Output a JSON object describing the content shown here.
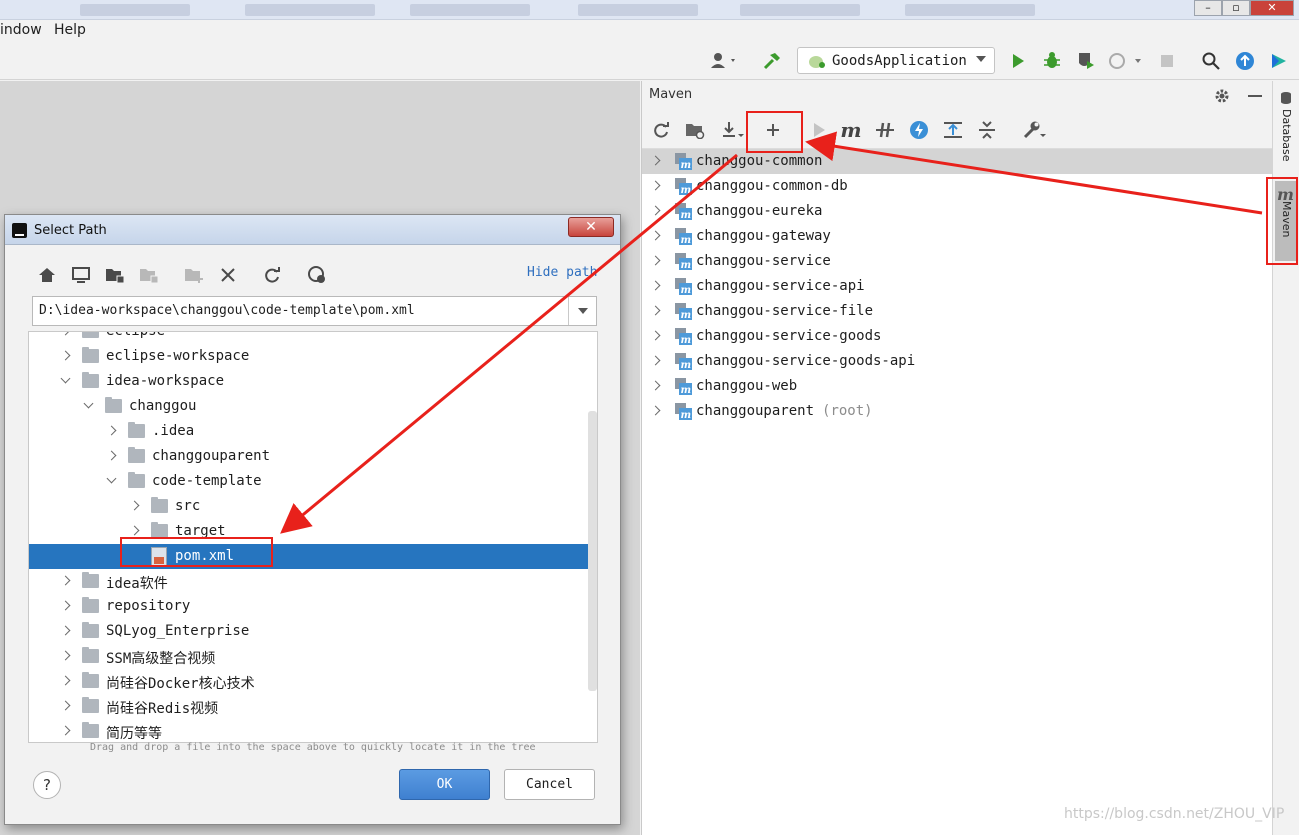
{
  "menubar": {
    "items": [
      "indow",
      "Help"
    ]
  },
  "toolbar": {
    "run_config": "GoodsApplication"
  },
  "maven": {
    "title": "Maven",
    "projects": [
      {
        "name": "changgou-common",
        "tag": ""
      },
      {
        "name": "changgou-common-db",
        "tag": ""
      },
      {
        "name": "changgou-eureka",
        "tag": ""
      },
      {
        "name": "changgou-gateway",
        "tag": ""
      },
      {
        "name": "changgou-service",
        "tag": ""
      },
      {
        "name": "changgou-service-api",
        "tag": ""
      },
      {
        "name": "changgou-service-file",
        "tag": ""
      },
      {
        "name": "changgou-service-goods",
        "tag": ""
      },
      {
        "name": "changgou-service-goods-api",
        "tag": ""
      },
      {
        "name": "changgou-web",
        "tag": ""
      },
      {
        "name": "changgouparent",
        "tag": "(root)"
      }
    ]
  },
  "side_tabs": {
    "database": "Database",
    "maven": "Maven"
  },
  "dialog": {
    "title": "Select Path",
    "hide_path": "Hide path",
    "path_value": "D:\\idea-workspace\\changgou\\code-template\\pom.xml",
    "tree": [
      {
        "label": "eclipse",
        "type": "folder",
        "indent": 0,
        "expanded": false,
        "selected": false
      },
      {
        "label": "eclipse-workspace",
        "type": "folder",
        "indent": 0,
        "expanded": false,
        "selected": false
      },
      {
        "label": "idea-workspace",
        "type": "folder",
        "indent": 0,
        "expanded": true,
        "selected": false
      },
      {
        "label": "changgou",
        "type": "folder",
        "indent": 1,
        "expanded": true,
        "selected": false
      },
      {
        "label": ".idea",
        "type": "folder",
        "indent": 2,
        "expanded": false,
        "selected": false
      },
      {
        "label": "changgouparent",
        "type": "folder",
        "indent": 2,
        "expanded": false,
        "selected": false
      },
      {
        "label": "code-template",
        "type": "folder",
        "indent": 2,
        "expanded": true,
        "selected": false
      },
      {
        "label": "src",
        "type": "folder",
        "indent": 3,
        "expanded": false,
        "selected": false
      },
      {
        "label": "target",
        "type": "folder",
        "indent": 3,
        "expanded": false,
        "selected": false
      },
      {
        "label": "pom.xml",
        "type": "xml",
        "indent": 3,
        "expanded": null,
        "selected": true
      },
      {
        "label": "idea软件",
        "type": "folder",
        "indent": 0,
        "expanded": false,
        "selected": false
      },
      {
        "label": "repository",
        "type": "folder",
        "indent": 0,
        "expanded": false,
        "selected": false
      },
      {
        "label": "SQLyog_Enterprise",
        "type": "folder",
        "indent": 0,
        "expanded": false,
        "selected": false
      },
      {
        "label": "SSM高级整合视频",
        "type": "folder",
        "indent": 0,
        "expanded": false,
        "selected": false
      },
      {
        "label": "尚硅谷Docker核心技术",
        "type": "folder",
        "indent": 0,
        "expanded": false,
        "selected": false
      },
      {
        "label": "尚硅谷Redis视频",
        "type": "folder",
        "indent": 0,
        "expanded": false,
        "selected": false
      },
      {
        "label": "简历等等",
        "type": "folder",
        "indent": 0,
        "expanded": false,
        "selected": false
      }
    ],
    "dnd_hint": "Drag and drop a file into the space above to quickly locate it in the tree",
    "help_label": "?",
    "ok_label": "OK",
    "cancel_label": "Cancel"
  },
  "icons": {
    "toolbar": [
      "user-icon",
      "build-hammer-icon",
      "run-icon",
      "debug-icon",
      "coverage-icon",
      "profile-icon",
      "stop-icon",
      "search-icon",
      "update-icon",
      "plugin-icon"
    ],
    "maven_toolbar": [
      "reimport-icon",
      "generate-sources-icon",
      "download-icon",
      "add-maven-project-icon",
      "run-maven-build-icon",
      "execute-goal-icon",
      "toggle-offline-icon",
      "skip-tests-icon",
      "show-dependencies-icon",
      "collapse-all-icon",
      "settings-wrench-icon"
    ],
    "dialog_toolbar": [
      "home-icon",
      "desktop-icon",
      "project-folder-icon",
      "module-folder-icon",
      "new-folder-icon",
      "delete-icon",
      "refresh-icon",
      "show-hidden-icon"
    ]
  },
  "colors": {
    "accent": "#2675bf",
    "annotation_red": "#e8211b",
    "run_green": "#3c9b2d"
  },
  "watermark": "https://blog.csdn.net/ZHOU_VIP"
}
